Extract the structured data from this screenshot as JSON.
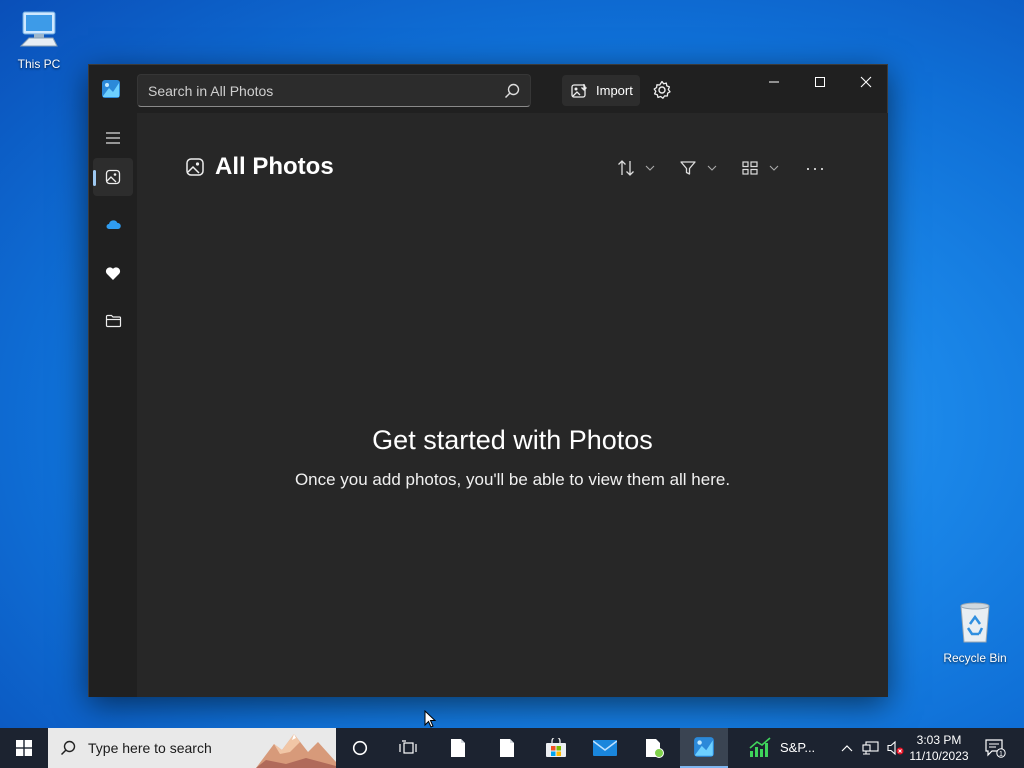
{
  "desktop": {
    "icons": [
      {
        "label": "This PC",
        "icon": "this-pc-icon"
      },
      {
        "label": "Recycle Bin",
        "icon": "recycle-bin-icon"
      }
    ]
  },
  "window": {
    "app": "Photos",
    "search": {
      "placeholder": "Search in All Photos"
    },
    "import_label": "Import",
    "settings_icon": "gear-icon",
    "controls": [
      "minimize",
      "maximize",
      "close"
    ],
    "sidebar": [
      {
        "id": "hamburger",
        "icon": "menu-icon"
      },
      {
        "id": "all-photos",
        "icon": "photo-icon",
        "active": true
      },
      {
        "id": "onedrive",
        "icon": "cloud-icon"
      },
      {
        "id": "favorites",
        "icon": "heart-icon"
      },
      {
        "id": "folders",
        "icon": "folder-icon"
      }
    ],
    "page_title": "All Photos",
    "toolbar": [
      "sort",
      "filter",
      "view",
      "more"
    ],
    "more_label": "···",
    "empty_title": "Get started with Photos",
    "empty_subtitle": "Once you add photos, you'll be able to view them all here."
  },
  "taskbar": {
    "search_placeholder": "Type here to search",
    "pinned": [
      {
        "name": "cortana",
        "icon": "cortana-icon"
      },
      {
        "name": "task-view",
        "icon": "task-view-icon"
      },
      {
        "name": "notepad-1",
        "icon": "file-icon"
      },
      {
        "name": "notepad-2",
        "icon": "file-icon"
      },
      {
        "name": "store",
        "icon": "store-icon"
      },
      {
        "name": "mail",
        "icon": "mail-icon"
      },
      {
        "name": "file-manager",
        "icon": "file-icon"
      },
      {
        "name": "photos",
        "icon": "photos-icon",
        "active": true
      },
      {
        "name": "stocks",
        "icon": "chart-icon"
      }
    ],
    "stocks_label": "S&P...",
    "time": "3:03 PM",
    "date": "11/10/2023",
    "notifications_count": "1"
  },
  "colors": {
    "window_bg": "#202020",
    "content_bg": "#272727",
    "accent": "#9ec8f0",
    "taskbar_bg": "#1c2330"
  }
}
